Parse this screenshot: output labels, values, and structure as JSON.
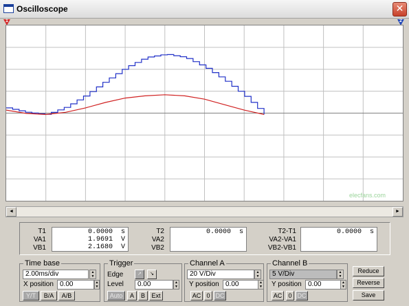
{
  "window": {
    "title": "Oscilloscope",
    "close_glyph": "✕"
  },
  "markers": {
    "t1": "1",
    "t2": "2"
  },
  "watermark": "elecfans.com",
  "scrollbar": {
    "left_glyph": "◄",
    "right_glyph": "►"
  },
  "readout": {
    "t1": {
      "labels": [
        "T1",
        "VA1",
        "VB1"
      ],
      "lines": [
        "0.0000  s",
        "1.9691  V",
        "2.1680  V"
      ]
    },
    "t2": {
      "labels": [
        "T2",
        "VA2",
        "VB2"
      ],
      "lines": [
        "0.0000  s",
        "",
        ""
      ]
    },
    "t2t1": {
      "labels": [
        "T2-T1",
        "VA2-VA1",
        "VB2-VB1"
      ],
      "lines": [
        "0.0000  s",
        "",
        ""
      ]
    }
  },
  "timebase": {
    "title": "Time base",
    "value": "2.00ms/div",
    "xpos_label": "X position",
    "xpos_value": "0.00",
    "buttons": [
      "Y/T",
      "B/A",
      "A/B"
    ]
  },
  "trigger": {
    "title": "Trigger",
    "edge_label": "Edge",
    "level_label": "Level",
    "level_value": "0.00",
    "buttons": [
      "Auto",
      "A",
      "B",
      "Ext"
    ]
  },
  "channel_a": {
    "title": "Channel A",
    "value": "20 V/Div",
    "ypos_label": "Y position",
    "ypos_value": "0.00",
    "buttons": [
      "AC",
      "0",
      "DC"
    ]
  },
  "channel_b": {
    "title": "Channel B",
    "value": "5 V/Div",
    "ypos_label": "Y position",
    "ypos_value": "0.00",
    "buttons": [
      "AC",
      "0",
      "DC"
    ]
  },
  "actions": {
    "reduce": "Reduce",
    "reverse": "Reverse",
    "save": "Save"
  },
  "colors": {
    "channel_a": "#2030c8",
    "channel_b": "#d02020",
    "grid": "#c0c0c0",
    "axis": "#808080"
  },
  "chart_data": {
    "type": "line",
    "grid": true,
    "x_divisions": 10,
    "y_divisions": 8,
    "series": [
      {
        "color": "#2030c8",
        "x": [
          0,
          5,
          10,
          15,
          20,
          25,
          30,
          35,
          40,
          45,
          50,
          55,
          60,
          65
        ],
        "y": [
          0.3,
          0.1,
          0.0,
          0.35,
          0.9,
          1.55,
          2.15,
          2.6,
          2.75,
          2.6,
          2.15,
          1.55,
          0.85,
          0.0
        ]
      },
      {
        "color": "#d02020",
        "x": [
          0,
          5,
          10,
          15,
          20,
          25,
          30,
          35,
          40,
          45,
          50,
          55,
          60,
          65
        ],
        "y": [
          0.2,
          0.05,
          0.0,
          0.1,
          0.3,
          0.55,
          0.75,
          0.85,
          0.9,
          0.85,
          0.7,
          0.45,
          0.2,
          0.0
        ]
      }
    ]
  }
}
